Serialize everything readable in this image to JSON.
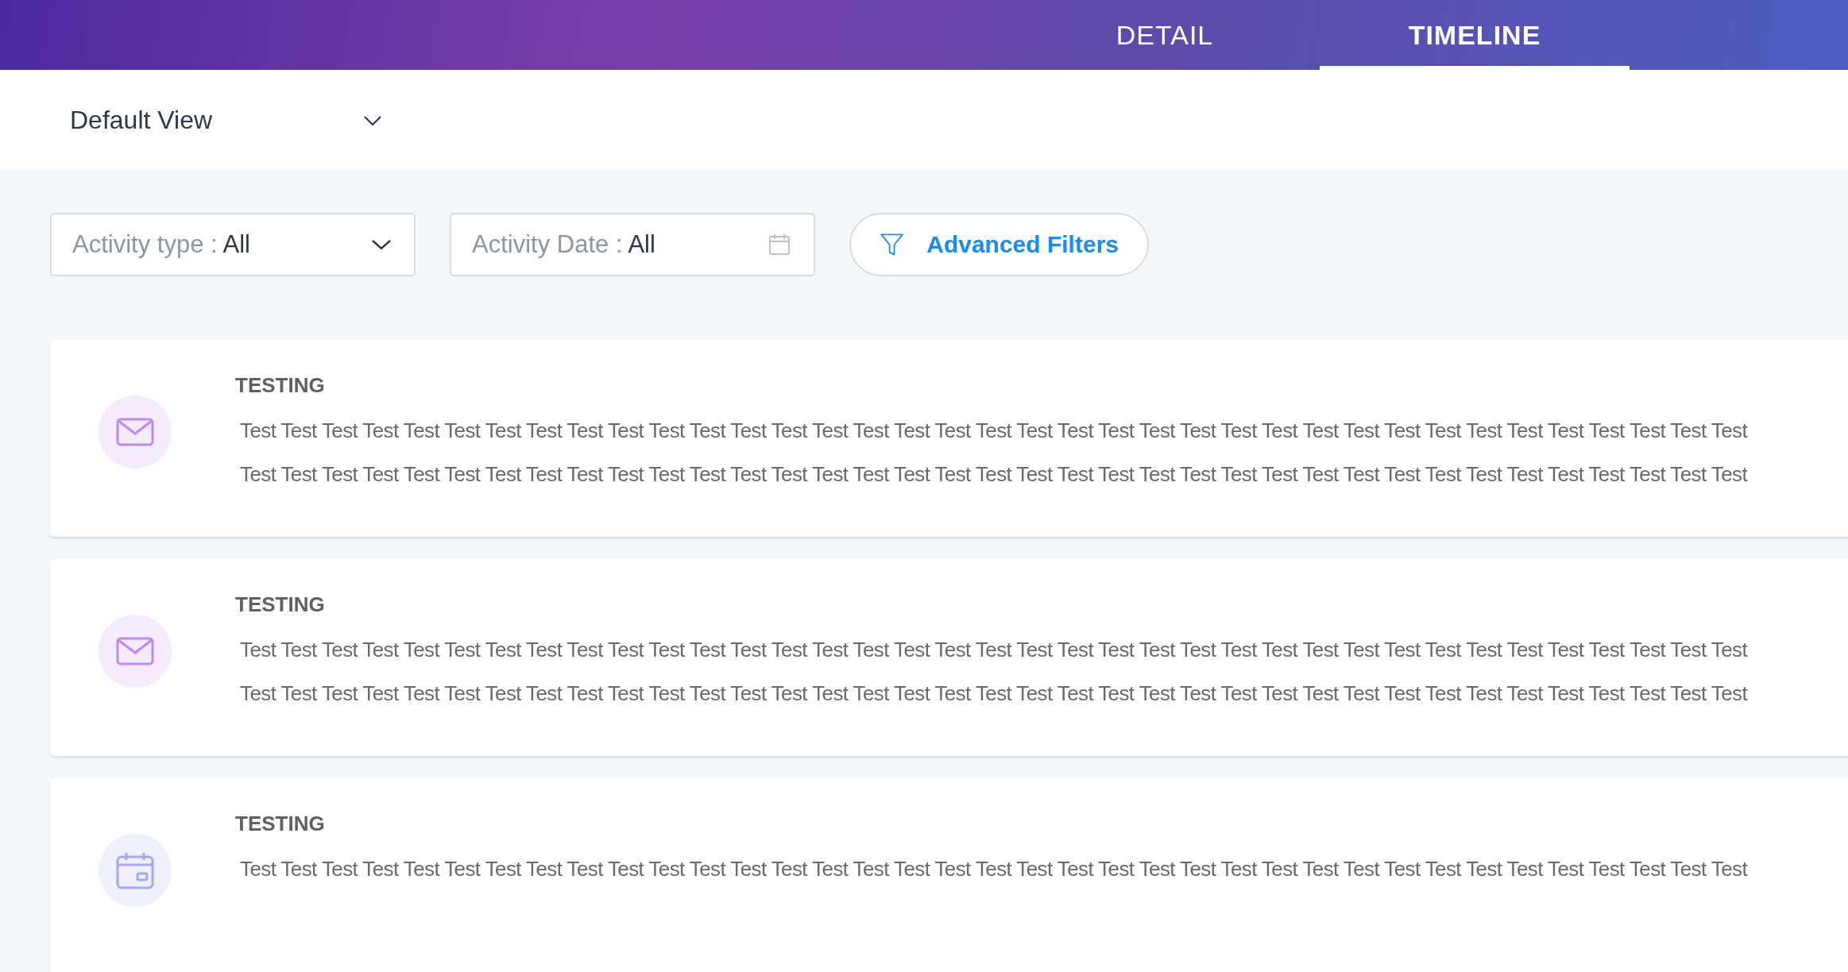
{
  "tabs": [
    {
      "label": "DETAIL",
      "selected": false
    },
    {
      "label": "TIMELINE",
      "selected": true
    }
  ],
  "view_selector": {
    "value": "Default View"
  },
  "filters": [
    {
      "kind": "dropdown",
      "label": "Activity type :",
      "value": "All"
    },
    {
      "kind": "date",
      "label": "Activity Date :",
      "value": "All"
    }
  ],
  "advanced_filters_button": {
    "label": "Advanced Filters"
  },
  "activities": [
    {
      "kind": "email",
      "title": "TESTING",
      "lines": [
        "Test Test Test Test Test Test Test Test Test Test Test Test Test Test Test Test Test Test Test Test Test Test Test Test Test Test Test Test Test Test Test Test Test Test Test Test Test",
        "Test Test Test Test Test Test Test Test Test Test Test Test Test Test Test Test Test Test Test Test Test Test Test Test Test Test Test Test Test Test Test Test Test Test Test Test Test"
      ]
    },
    {
      "kind": "email",
      "title": "TESTING",
      "lines": [
        "Test Test Test Test Test Test Test Test Test Test Test Test Test Test Test Test Test Test Test Test Test Test Test Test Test Test Test Test Test Test Test Test Test Test Test Test Test",
        "Test Test Test Test Test Test Test Test Test Test Test Test Test Test Test Test Test Test Test Test Test Test Test Test Test Test Test Test Test Test Test Test Test Test Test Test Test"
      ]
    },
    {
      "kind": "event",
      "title": "TESTING",
      "lines": [
        "Test Test Test Test Test Test Test Test Test Test Test Test Test Test Test Test Test Test Test Test Test Test Test Test Test Test Test Test Test Test Test Test Test Test Test Test Test"
      ]
    }
  ]
}
